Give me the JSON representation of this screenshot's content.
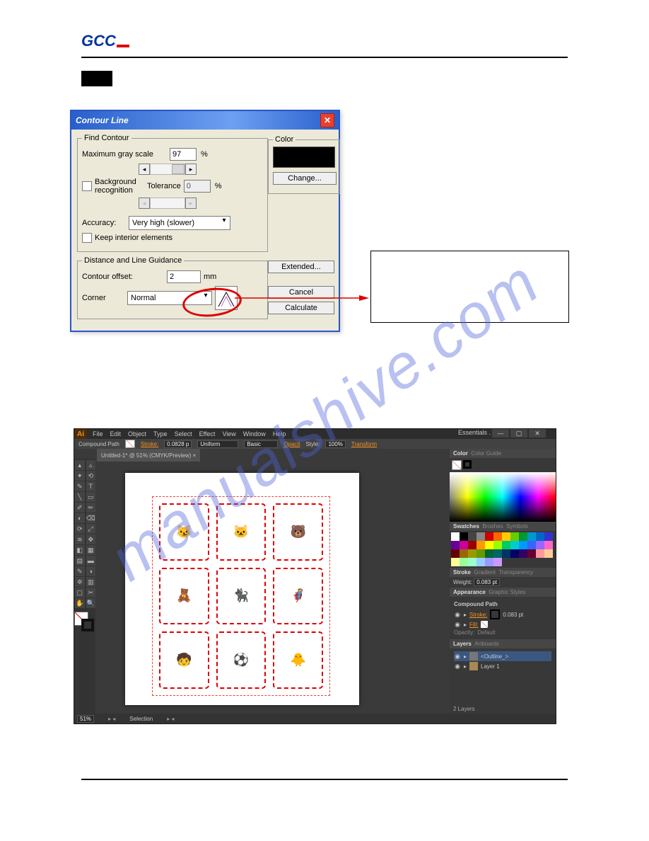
{
  "logo": "GCC",
  "watermark": "manualshive.com",
  "dialog": {
    "title": "Contour Line",
    "find_contour": {
      "legend": "Find Contour",
      "max_gray_label": "Maximum gray scale",
      "max_gray_value": "97",
      "pct": "%",
      "bg_recog": "Background\nrecognition",
      "tolerance_label": "Tolerance",
      "tolerance_value": "0",
      "accuracy_label": "Accuracy:",
      "accuracy_value": "Very high (slower)",
      "keep_interior": "Keep interior elements"
    },
    "dist": {
      "legend": "Distance and Line Guidance",
      "offset_label": "Contour offset:",
      "offset_value": "2",
      "offset_unit": "mm",
      "corner_label": "Corner",
      "corner_value": "Normal"
    },
    "color": {
      "legend": "Color",
      "change": "Change..."
    },
    "buttons": {
      "extended": "Extended...",
      "cancel": "Cancel",
      "calculate": "Calculate"
    }
  },
  "ai": {
    "menu": [
      "File",
      "Edit",
      "Object",
      "Type",
      "Select",
      "Effect",
      "View",
      "Window",
      "Help"
    ],
    "essentials": "Essentials .",
    "control": {
      "kind": "Compound Path",
      "stroke_lbl": "Stroke:",
      "stroke_val": "0.0828 p",
      "uniform": "Uniform",
      "basic": "Basic",
      "opacity": "Opacit",
      "style": "Style:",
      "zoom": "100%",
      "transform": "Transform"
    },
    "tab": "Untitled-1* @ 51% (CMYK/Preview) ×",
    "panels": {
      "color": "Color",
      "color_guide": "Color Guide",
      "swatches": "Swatches",
      "brushes": "Brushes",
      "symbols": "Symbols",
      "stroke_tab": "Stroke",
      "gradient": "Gradient",
      "transparency": "Transparency",
      "weight_lbl": "Weight:",
      "weight_val": "0.083 pt",
      "appearance": "Appearance",
      "graphic_styles": "Graphic Styles",
      "compound_path": "Compound Path",
      "stroke": "Stroke:",
      "stroke_c": "0.083 pt",
      "fill": "Fill:",
      "opacity": "Opacity:",
      "default": "Default",
      "layers": "Layers",
      "artboards": "Artboards",
      "layer1": "<Outline_>",
      "layer2": "Layer 1",
      "count": "2 Layers"
    },
    "status": {
      "zoom": "51%",
      "sel": "Selection"
    },
    "swatch_colors": [
      "#fff",
      "#000",
      "#444",
      "#888",
      "#c00",
      "#f60",
      "#fc0",
      "#6c0",
      "#093",
      "#09c",
      "#06c",
      "#33c",
      "#609",
      "#c09",
      "#900",
      "#f90",
      "#ff0",
      "#9f0",
      "#0c6",
      "#0cc",
      "#09f",
      "#36f",
      "#96f",
      "#f6c",
      "#600",
      "#960",
      "#990",
      "#690",
      "#063",
      "#066",
      "#036",
      "#006",
      "#306",
      "#603",
      "#f99",
      "#fc9",
      "#ff9",
      "#9f9",
      "#9fc",
      "#9cf",
      "#99f",
      "#c9f"
    ]
  }
}
